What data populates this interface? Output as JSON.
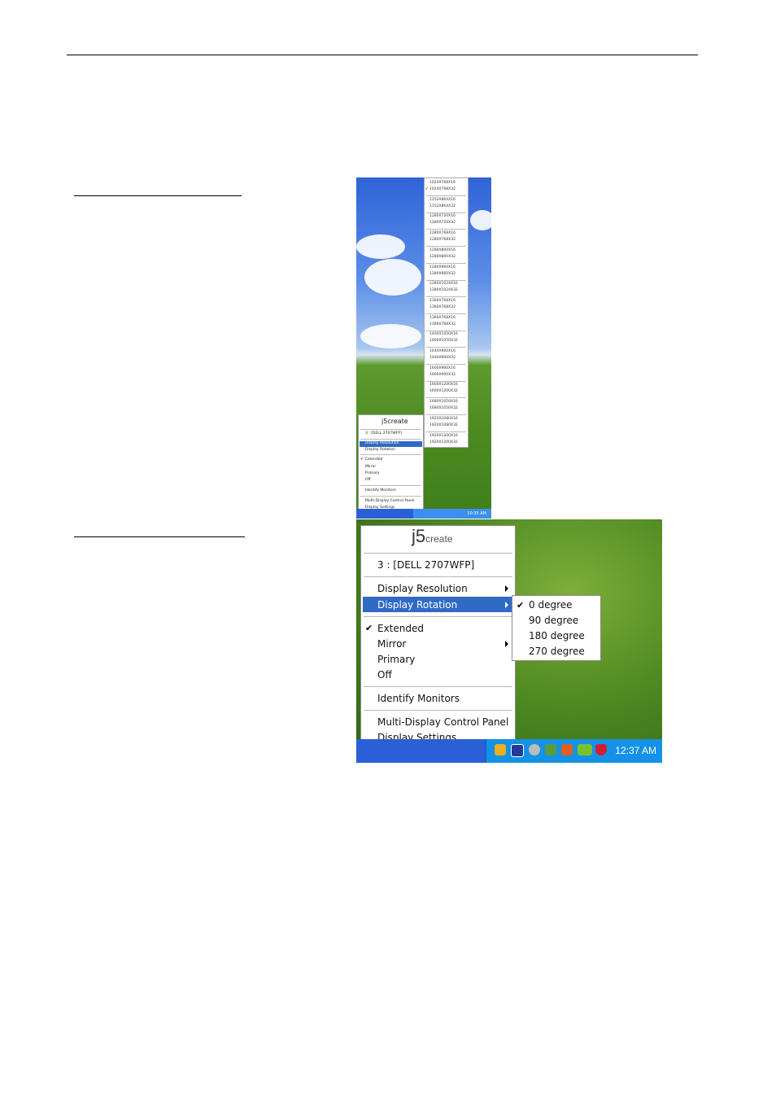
{
  "screenshot1": {
    "resolutions": [
      "1024X768X16",
      "1024X768X32",
      "1152X864X16",
      "1152X864X32",
      "1280X720X16",
      "1280X720X32",
      "1280X768X16",
      "1280X768X32",
      "1280X800X16",
      "1280X800X32",
      "1280X960X16",
      "1280X960X32",
      "1280X1024X16",
      "1280X1024X32",
      "1360X768X16",
      "1360X768X32",
      "1366X768X16",
      "1366X768X32",
      "1400X1050X16",
      "1400X1050X32",
      "1440X900X16",
      "1440X900X32",
      "1600X900X16",
      "1600X900X32",
      "1600X1200X16",
      "1600X1200X32",
      "1680X1050X16",
      "1680X1050X32",
      "1920X1080X16",
      "1920X1080X32",
      "1920X1200X16",
      "1920X1200X32"
    ],
    "selected_resolution": "1024X768X32",
    "menu": {
      "logo": "j5create",
      "monitor": "3 : [DELL 2707WFP]",
      "display_resolution": "Display Resolution",
      "display_rotation": "Display Rotation",
      "extended": "Extended",
      "mirror": "Mirror",
      "primary": "Primary",
      "off": "Off",
      "identify": "Identify Monitors",
      "control_panel": "Multi-Display Control Panel",
      "settings": "Display Settings"
    },
    "clock": "10:35 AM"
  },
  "screenshot2": {
    "menu": {
      "logo_main": "j5",
      "logo_sub": "create",
      "monitor": "3 : [DELL 2707WFP]",
      "display_resolution": "Display Resolution",
      "display_rotation": "Display Rotation",
      "extended": "Extended",
      "mirror": "Mirror",
      "primary": "Primary",
      "off": "Off",
      "identify": "Identify Monitors",
      "control_panel": "Multi-Display Control Panel",
      "settings": "Display Settings"
    },
    "rotation_options": [
      "0 degree",
      "90 degree",
      "180 degree",
      "270 degree"
    ],
    "selected_rotation": "0 degree",
    "clock": "12:37 AM",
    "highlight_color": "#316ac5",
    "taskbar_color": "#2a5fd8"
  }
}
